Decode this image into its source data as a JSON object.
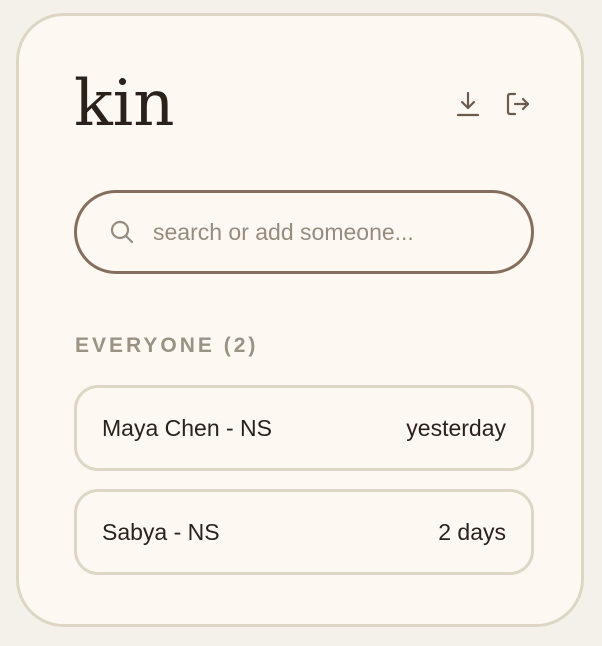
{
  "app": {
    "logo_text": "kin"
  },
  "header": {
    "download_icon": "download-icon",
    "logout_icon": "logout-icon"
  },
  "search": {
    "placeholder": "search or add someone...",
    "value": "",
    "icon": "search-icon"
  },
  "section": {
    "label": "EVERYONE (2)"
  },
  "people": [
    {
      "name": "Maya Chen - NS",
      "last_contact": "yesterday"
    },
    {
      "name": "Sabya - NS",
      "last_contact": "2 days"
    }
  ],
  "colors": {
    "background": "#f4f1ea",
    "card": "#fdf9f2",
    "card_border": "#ddd6c6",
    "search_border": "#856e5e",
    "text": "#2b211b",
    "muted": "#9a9285",
    "icon": "#6b5a4e"
  }
}
